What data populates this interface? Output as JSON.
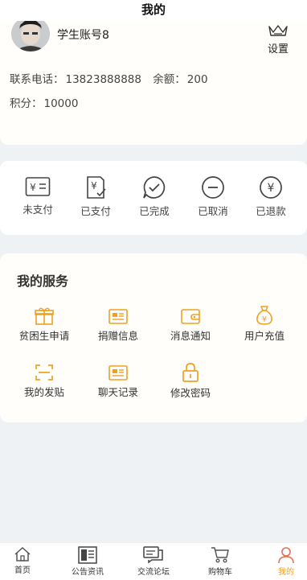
{
  "header": {
    "title": "我的"
  },
  "profile": {
    "username": "学生账号8",
    "settings_label": "设置",
    "phone_label": "联系电话：",
    "phone": "13823888888",
    "balance_label": "余额：",
    "balance": "200",
    "points_label": "积分：",
    "points": "10000"
  },
  "orders": [
    {
      "label": "未支付",
      "icon": "unpaid-icon"
    },
    {
      "label": "已支付",
      "icon": "paid-icon"
    },
    {
      "label": "已完成",
      "icon": "completed-icon"
    },
    {
      "label": "已取消",
      "icon": "cancelled-icon"
    },
    {
      "label": "已退款",
      "icon": "refunded-icon"
    }
  ],
  "services": {
    "title": "我的服务",
    "items": [
      {
        "label": "贫困生申请",
        "icon": "gift-icon"
      },
      {
        "label": "捐赠信息",
        "icon": "card-icon"
      },
      {
        "label": "消息通知",
        "icon": "wallet-icon"
      },
      {
        "label": "用户充值",
        "icon": "money-bag-icon"
      },
      {
        "label": "我的发贴",
        "icon": "scan-icon"
      },
      {
        "label": "聊天记录",
        "icon": "card-icon"
      },
      {
        "label": "修改密码",
        "icon": "lock-icon"
      }
    ]
  },
  "tabbar": {
    "items": [
      {
        "label": "首页",
        "icon": "home-icon"
      },
      {
        "label": "公告资讯",
        "icon": "news-icon"
      },
      {
        "label": "交流论坛",
        "icon": "forum-icon"
      },
      {
        "label": "购物车",
        "icon": "cart-icon"
      },
      {
        "label": "我的",
        "icon": "user-icon"
      }
    ],
    "active_index": 4
  },
  "colors": {
    "accent": "#f0a020",
    "icon_dark": "#444444",
    "background": "#eef2f4"
  }
}
